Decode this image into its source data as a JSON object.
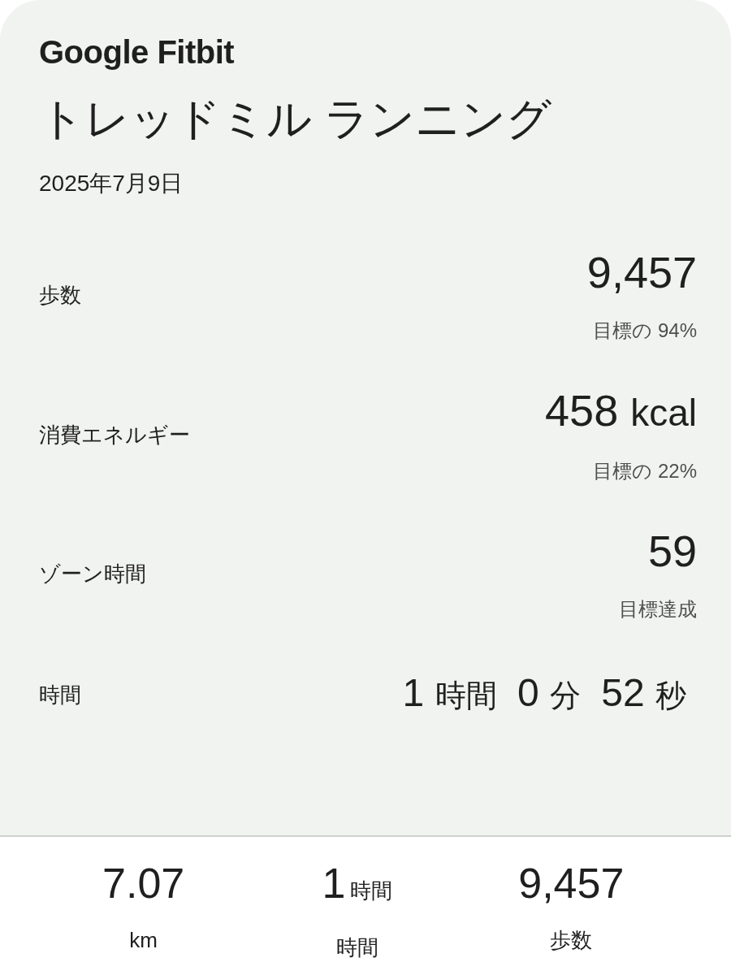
{
  "logo": "Google Fitbit",
  "title": "トレッドミル ランニング",
  "date": "2025年7月9日",
  "metrics": [
    {
      "kind": "goal",
      "label": "歩数",
      "value": "9,457",
      "goal": "目標の 94%"
    },
    {
      "kind": "goal",
      "label": "消費エネルギー",
      "value": "458",
      "unit": "kcal",
      "goal": "目標の 22%"
    },
    {
      "kind": "goal",
      "label": "ゾーン時間",
      "value": "59",
      "goal": "目標達成"
    },
    {
      "kind": "duration",
      "label": "時間",
      "parts": [
        {
          "number": "1",
          "unit": "時間"
        },
        {
          "number": "0",
          "unit": "分"
        },
        {
          "number": "52",
          "unit": "秒"
        }
      ]
    }
  ],
  "summary": [
    {
      "value": "7.07",
      "label": "km"
    },
    {
      "value": "1",
      "unit": "時間",
      "label": "時間"
    },
    {
      "value": "9,457",
      "label": "歩数"
    }
  ]
}
